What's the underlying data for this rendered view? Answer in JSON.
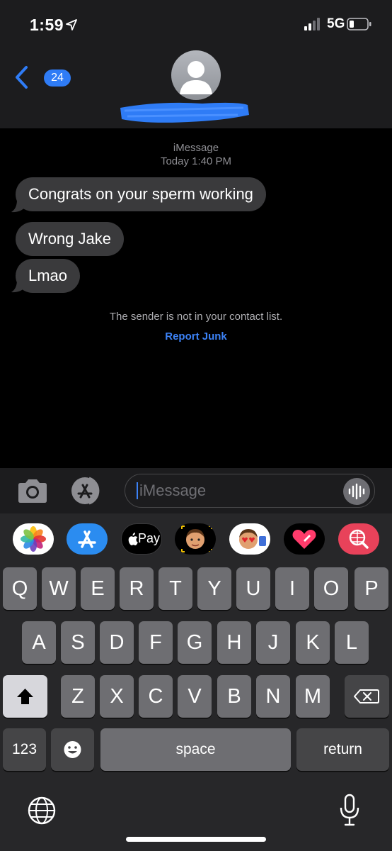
{
  "status_bar": {
    "time": "1:59",
    "network": "5G"
  },
  "header": {
    "back_count": "24"
  },
  "conversation": {
    "service": "iMessage",
    "timestamp": "Today 1:40 PM",
    "messages": [
      {
        "text": "Congrats on your sperm working"
      },
      {
        "text": "Wrong Jake"
      },
      {
        "text": "Lmao"
      }
    ],
    "unknown_sender_notice": "The sender is not in your contact list.",
    "report_junk_label": "Report Junk"
  },
  "input": {
    "placeholder": "iMessage"
  },
  "app_drawer": {
    "apple_pay_label": "Pay"
  },
  "keyboard": {
    "row1": [
      "Q",
      "W",
      "E",
      "R",
      "T",
      "Y",
      "U",
      "I",
      "O",
      "P"
    ],
    "row2": [
      "A",
      "S",
      "D",
      "F",
      "G",
      "H",
      "J",
      "K",
      "L"
    ],
    "row3": [
      "Z",
      "X",
      "C",
      "V",
      "B",
      "N",
      "M"
    ],
    "numbers_label": "123",
    "space_label": "space",
    "return_label": "return"
  },
  "colors": {
    "accent": "#2f7cf6",
    "bubble": "#3a3a3c",
    "bar": "#1c1c1e",
    "keyboard": "#272729",
    "key": "#6e6e72"
  }
}
